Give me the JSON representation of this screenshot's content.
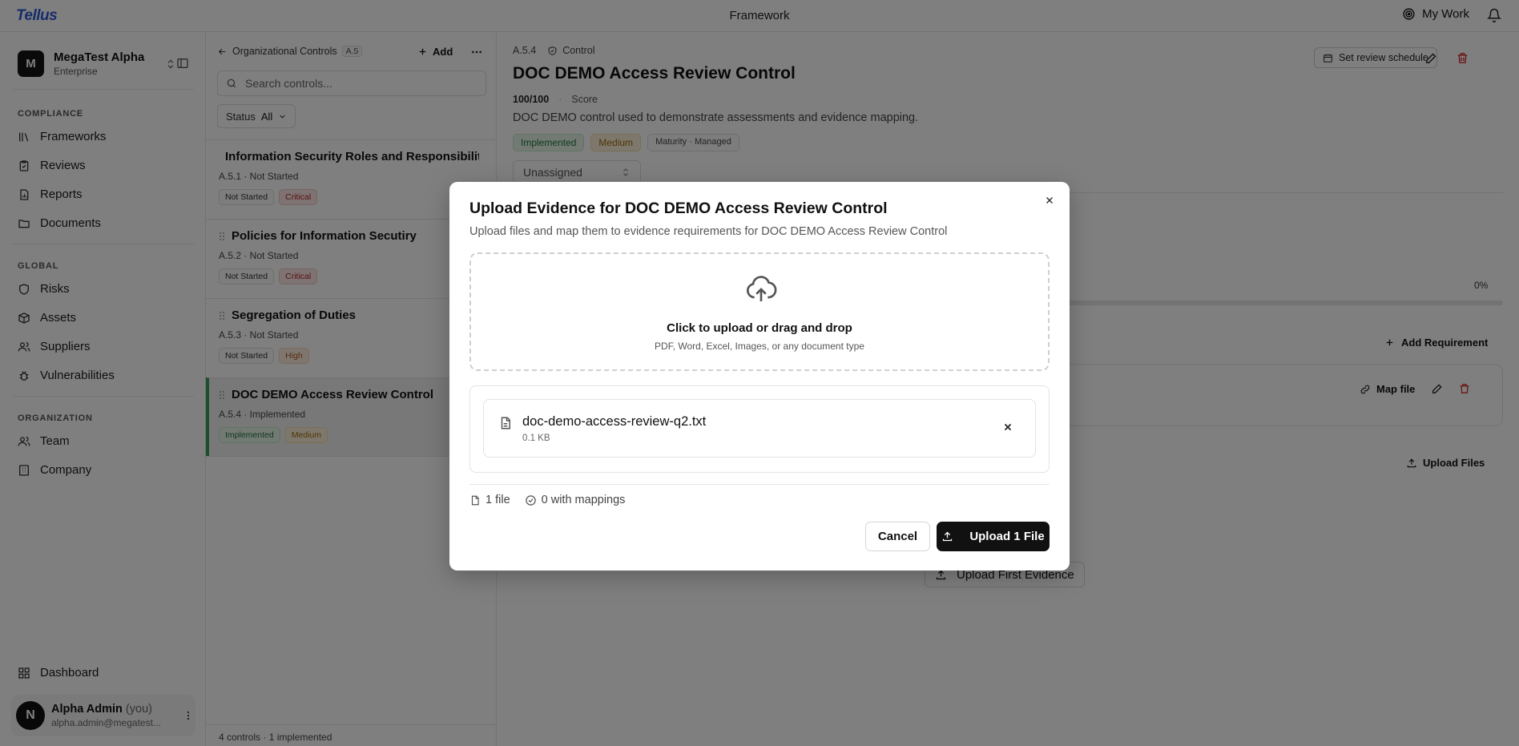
{
  "app": {
    "logo": "Tellus",
    "title": "Framework",
    "my_work": "My Work"
  },
  "org": {
    "initial": "M",
    "name": "MegaTest Alpha",
    "plan": "Enterprise"
  },
  "sidebar": {
    "compliance_label": "COMPLIANCE",
    "compliance": [
      {
        "label": "Frameworks"
      },
      {
        "label": "Reviews"
      },
      {
        "label": "Reports"
      },
      {
        "label": "Documents"
      }
    ],
    "global_label": "GLOBAL",
    "global": [
      {
        "label": "Risks"
      },
      {
        "label": "Assets"
      },
      {
        "label": "Suppliers"
      },
      {
        "label": "Vulnerabilities"
      }
    ],
    "organization_label": "ORGANIZATION",
    "organization": [
      {
        "label": "Team"
      },
      {
        "label": "Company"
      }
    ],
    "dashboard": "Dashboard"
  },
  "user": {
    "initial": "N",
    "name": "Alpha Admin",
    "you": "(you)",
    "email": "alpha.admin@megatest..."
  },
  "list": {
    "back_label": "Organizational Controls",
    "section_badge": "A.5",
    "add_label": "Add",
    "search_placeholder": "Search controls...",
    "status_label": "Status",
    "status_value": "All",
    "controls": [
      {
        "title": "Information Security Roles and Responsibilities",
        "meta": "A.5.1 · Not Started",
        "status": "Not Started",
        "priority": "Critical"
      },
      {
        "title": "Policies for Information Secutiry",
        "meta": "A.5.2 · Not Started",
        "status": "Not Started",
        "priority": "Critical"
      },
      {
        "title": "Segregation of Duties",
        "meta": "A.5.3 · Not Started",
        "status": "Not Started",
        "priority": "High"
      },
      {
        "title": "DOC DEMO Access Review Control",
        "meta": "A.5.4 · Implemented",
        "status": "Implemented",
        "priority": "Medium"
      }
    ],
    "footer": "4 controls · 1 implemented"
  },
  "main": {
    "code": "A.5.4",
    "type": "Control",
    "title": "DOC DEMO Access Review Control",
    "score": "100/100",
    "score_label": "Score",
    "description": "DOC DEMO control used to demonstrate assessments and evidence mapping.",
    "tags": {
      "status": "Implemented",
      "priority": "Medium",
      "maturity": "Maturity · Managed"
    },
    "assignee": "Unassigned",
    "review_button": "Set review schedule",
    "progress_text": "0%",
    "progress_value": 0,
    "add_requirement": "Add Requirement",
    "map_file": "Map file",
    "upload_files": "Upload Files",
    "upload_first": "Upload First Evidence"
  },
  "modal": {
    "title": "Upload Evidence for DOC DEMO Access Review Control",
    "subtitle": "Upload files and map them to evidence requirements for DOC DEMO Access Review Control",
    "drop_main": "Click to upload or drag and drop",
    "drop_sub": "PDF, Word, Excel, Images, or any document type",
    "file_name": "doc-demo-access-review-q2.txt",
    "file_size": "0.1 KB",
    "file_count": "1 file",
    "mappings": "0 with mappings",
    "cancel": "Cancel",
    "upload": "Upload 1 File"
  }
}
